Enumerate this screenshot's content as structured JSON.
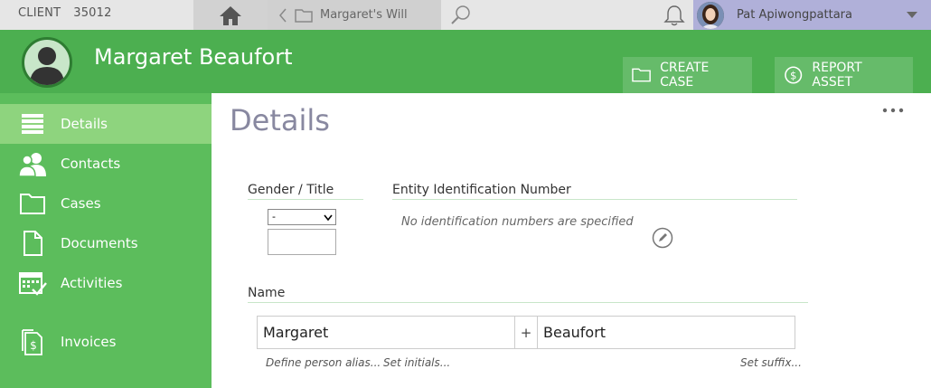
{
  "topbar": {
    "client_label": "CLIENT",
    "client_number": "35012",
    "tab_label": "Margaret's Will",
    "user_name": "Pat Apiwongpattara"
  },
  "header": {
    "person_name": "Margaret Beaufort",
    "create_case_label": "CREATE CASE",
    "report_asset_label": "REPORT ASSET"
  },
  "sidebar": {
    "items": [
      {
        "label": "Details",
        "icon": "list-icon",
        "active": true
      },
      {
        "label": "Contacts",
        "icon": "contacts-icon"
      },
      {
        "label": "Cases",
        "icon": "folder-icon"
      },
      {
        "label": "Documents",
        "icon": "document-icon"
      },
      {
        "label": "Activities",
        "icon": "calendar-check-icon"
      },
      {
        "label": "Invoices",
        "icon": "invoice-icon"
      }
    ]
  },
  "main": {
    "title": "Details",
    "gender_title_label": "Gender / Title",
    "gender_select_value": "-",
    "entity_id_label": "Entity Identification Number",
    "no_id_text": "No identification numbers are specified",
    "name_label": "Name",
    "first_name": "Margaret",
    "plus": "+",
    "last_name": "Beaufort",
    "define_alias": "Define person alias...",
    "set_initials": "Set initials...",
    "set_suffix": "Set suffix..."
  },
  "colors": {
    "header_green": "#4caf50",
    "sidebar_green": "#5cbd5c",
    "active_item": "#8ed47e",
    "user_bar": "#b0b0d9"
  }
}
